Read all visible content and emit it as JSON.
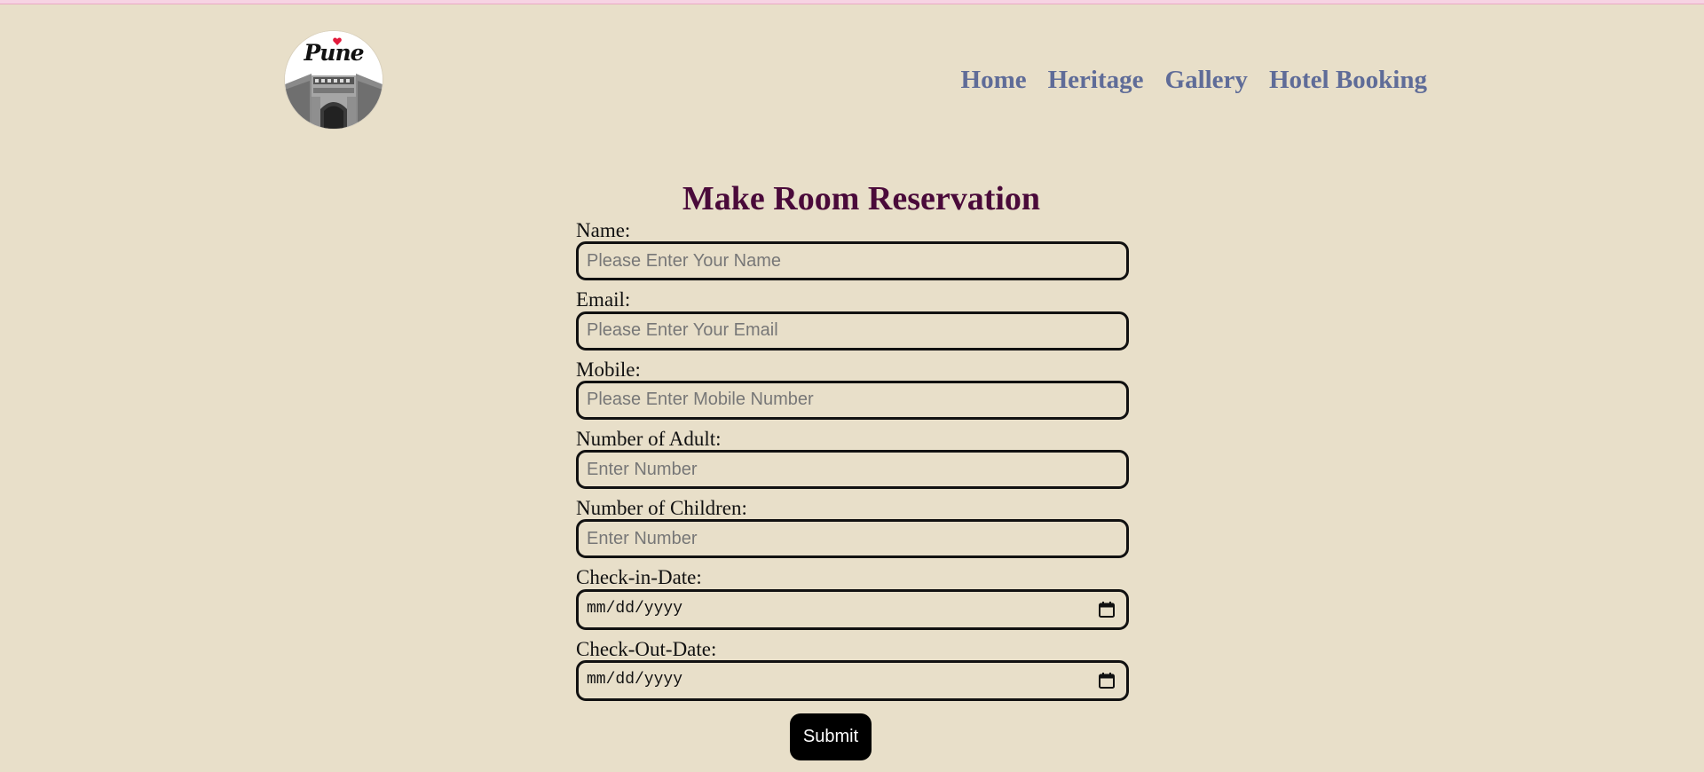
{
  "header": {
    "logo": {
      "text": "Pune",
      "icon": "heart-icon",
      "accent": "#e21b3c"
    },
    "nav": [
      {
        "label": "Home"
      },
      {
        "label": "Heritage"
      },
      {
        "label": "Gallery"
      },
      {
        "label": "Hotel Booking"
      }
    ]
  },
  "form": {
    "title": "Make Room Reservation",
    "fields": [
      {
        "label": "Name:",
        "placeholder": "Please Enter Your Name",
        "value": ""
      },
      {
        "label": "Email:",
        "placeholder": "Please Enter Your Email",
        "value": ""
      },
      {
        "label": "Mobile:",
        "placeholder": "Please Enter Mobile Number",
        "value": ""
      },
      {
        "label": "Number of Adult:",
        "placeholder": "Enter Number",
        "value": ""
      },
      {
        "label": "Number of Children:",
        "placeholder": "Enter Number",
        "value": ""
      }
    ],
    "dates": [
      {
        "label": "Check-in-Date:",
        "placeholder": "mm/dd/yyyy",
        "icon": "calendar-icon"
      },
      {
        "label": "Check-Out-Date:",
        "placeholder": "mm/dd/yyyy",
        "icon": "calendar-icon"
      }
    ],
    "submit_label": "Submit"
  },
  "colors": {
    "background": "#e8dfc9",
    "nav": "#5f6c98",
    "title": "#4a0a3a",
    "button": "#000000"
  }
}
